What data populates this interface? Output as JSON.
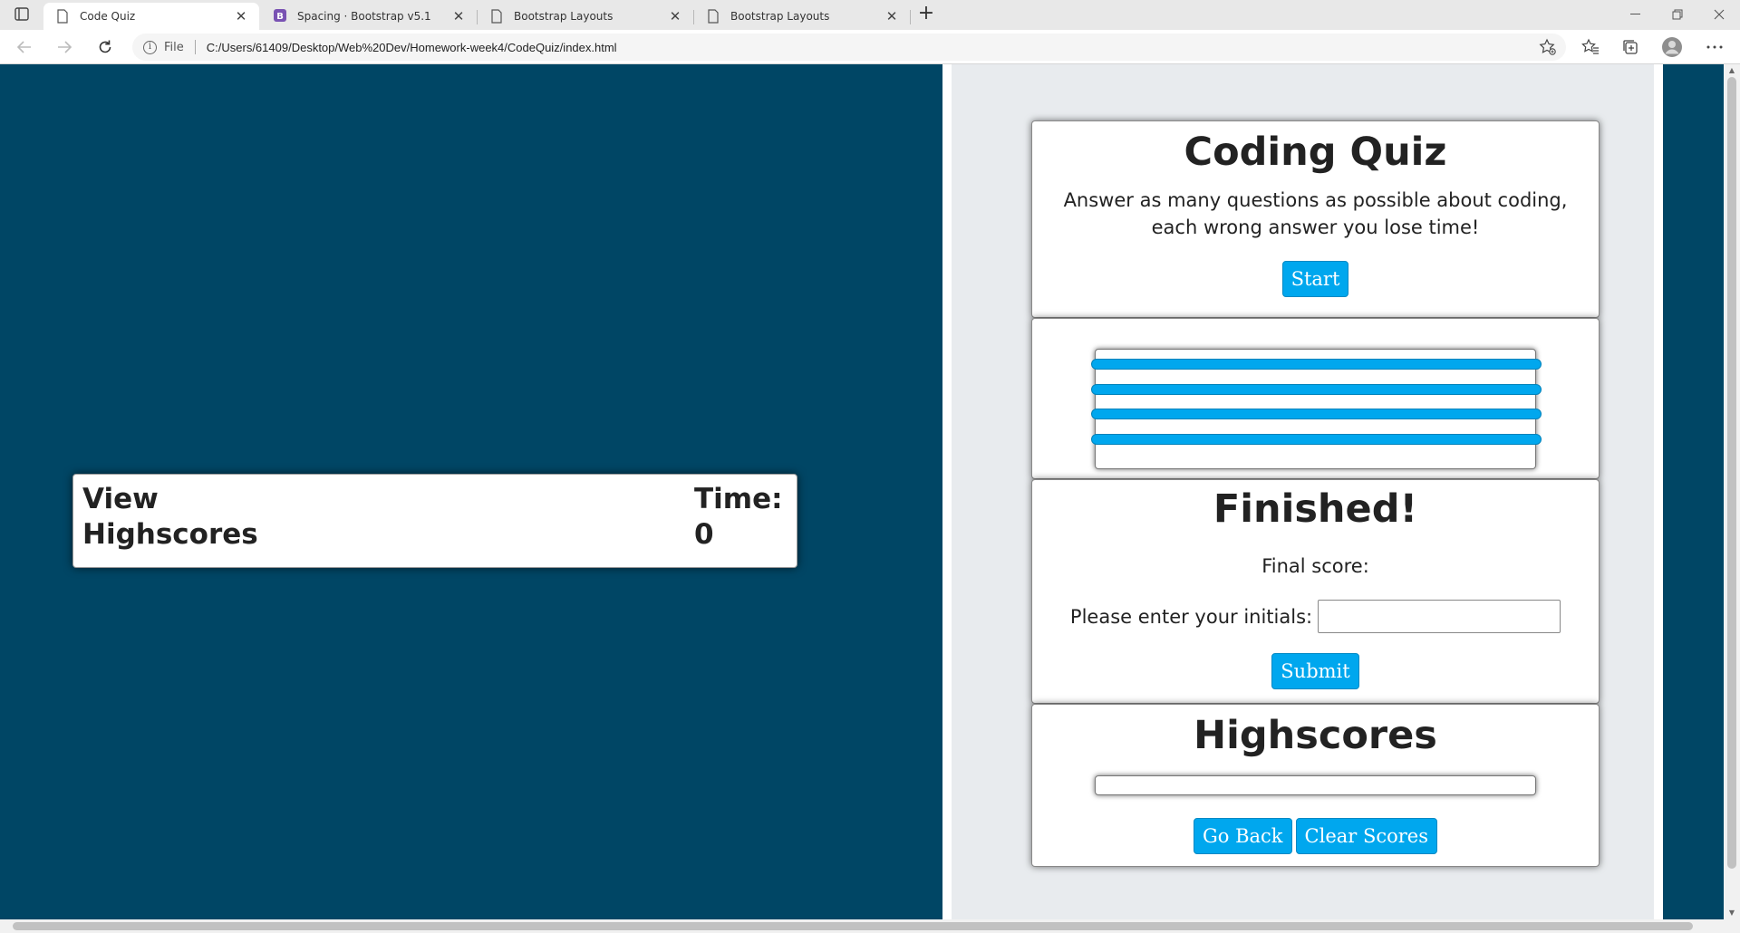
{
  "browser": {
    "tabs": [
      {
        "title": "Code Quiz",
        "active": true,
        "icon": "page-icon"
      },
      {
        "title": "Spacing · Bootstrap v5.1",
        "active": false,
        "icon": "bootstrap-icon"
      },
      {
        "title": "Bootstrap Layouts",
        "active": false,
        "icon": "page-icon"
      },
      {
        "title": "Bootstrap Layouts",
        "active": false,
        "icon": "page-icon"
      }
    ],
    "address": {
      "scheme_label": "File",
      "url": "C:/Users/61409/Desktop/Web%20Dev/Homework-week4/CodeQuiz/index.html"
    },
    "colors": {
      "bootstrap_purple": "#7952b3"
    }
  },
  "page": {
    "header": {
      "view_highscores": "View Highscores",
      "time_label": "Time:",
      "time_value": "0"
    },
    "start": {
      "title": "Coding Quiz",
      "description": "Answer as many questions as possible about coding, each wrong answer you lose time!",
      "start_button": "Start"
    },
    "question": {
      "answer_count": 4
    },
    "finished": {
      "title": "Finished!",
      "final_score_label": "Final score:",
      "initials_label": "Please enter your initials:",
      "initials_value": "",
      "submit_button": "Submit"
    },
    "highscores": {
      "title": "Highscores",
      "go_back_button": "Go Back",
      "clear_button": "Clear Scores"
    },
    "colors": {
      "background": "#004665",
      "panel": "#e8ebee",
      "button": "#00a7ee"
    }
  }
}
